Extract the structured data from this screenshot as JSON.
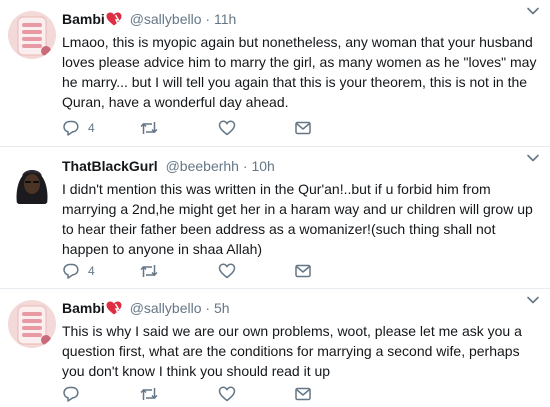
{
  "tweets": [
    {
      "name": "Bambi",
      "handle": "@sallybello",
      "dot": "·",
      "time": "11h",
      "text": "Lmaoo, this is myopic again  but nonetheless, any woman that your husband loves please advice him to marry the girl, as many women as he \"loves\" may he marry... but I will tell you again that this is your theorem, this is not in the Quran, have a wonderful day ahead.",
      "reply_count": "4",
      "has_emoji": true
    },
    {
      "name": "ThatBlackGurl",
      "handle": "@beeberhh",
      "dot": "·",
      "time": "10h",
      "text": "I didn't mention this was written in the Qur'an!..but if u forbid him from marrying a 2nd,he might get her in a haram way and ur children will grow up to hear their father been address as a womanizer!(such  thing shall not happen to anyone in shaa Allah)",
      "reply_count": "4",
      "has_emoji": false
    },
    {
      "name": "Bambi",
      "handle": "@sallybello",
      "dot": "·",
      "time": "5h",
      "text": "This is why I said we are our own problems, woot, please let me ask you a question first, what are the conditions for marrying a second wife, perhaps you don't know I think you should read it up",
      "reply_count": "",
      "has_emoji": true
    }
  ],
  "icons": {
    "reply": "reply-icon",
    "retweet": "retweet-icon",
    "like": "heart-icon",
    "dm": "envelope-icon",
    "caret": "chevron-down-icon",
    "name_emoji": "heart-emoji-icon"
  },
  "colors": {
    "text": "#14171a",
    "secondary": "#657786",
    "divider": "#e6ecf0",
    "heart_emoji": "#dd2e44"
  }
}
